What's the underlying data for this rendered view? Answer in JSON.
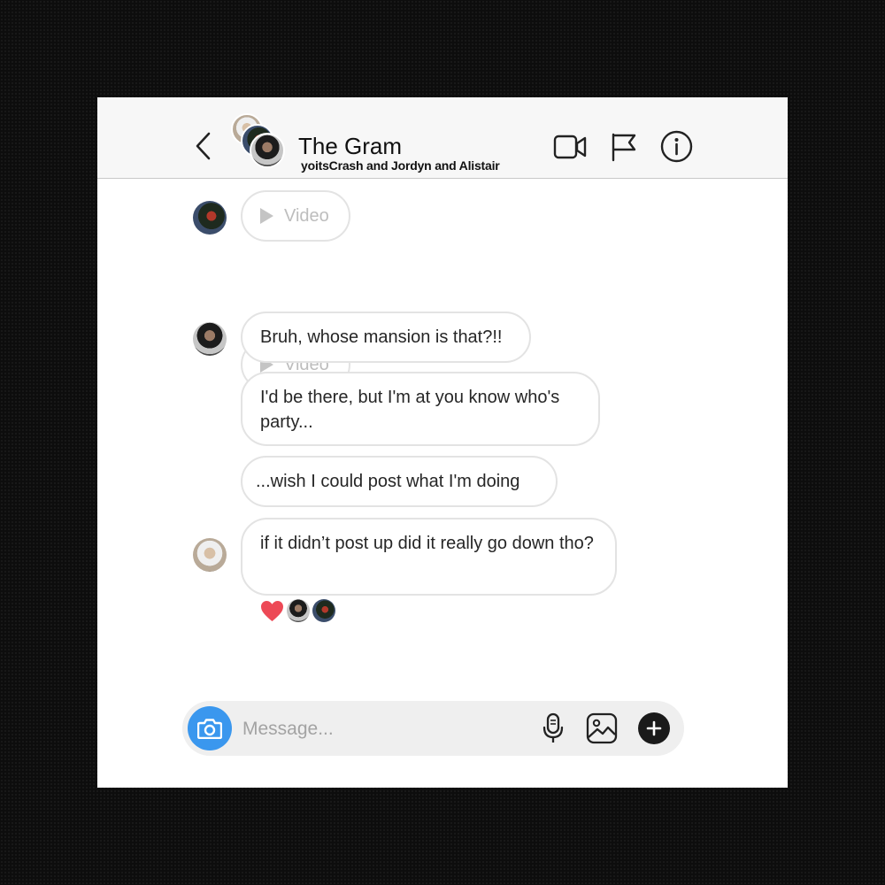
{
  "header": {
    "title": "The Gram",
    "participants": "yoitsCrash and Jordyn and Alistair",
    "icons": [
      "back-chevron-icon",
      "video-call-icon",
      "flag-icon",
      "info-icon"
    ]
  },
  "messages": [
    {
      "sender": "user-red",
      "type": "video",
      "label": "Video"
    },
    {
      "sender": "user-red",
      "type": "video",
      "label": "Video"
    },
    {
      "sender": "user-beard",
      "type": "text",
      "text": "Bruh, whose mansion is that?!!"
    },
    {
      "sender": "user-beard",
      "type": "text",
      "text": "I'd be there, but I'm at you know who's party..."
    },
    {
      "sender": "user-beard",
      "type": "text",
      "text": "...wish I could post what I'm doing"
    },
    {
      "sender": "user-smile",
      "type": "text",
      "text": "if it didn’t post up did it really go down tho?"
    }
  ],
  "reactions": [
    "heart",
    "user-beard",
    "user-red"
  ],
  "composer": {
    "placeholder": "Message...",
    "icons": [
      "camera-icon",
      "microphone-icon",
      "gallery-icon",
      "plus-icon"
    ]
  },
  "colors": {
    "background": "#0d0d0d",
    "camera_button": "#3a97ee",
    "heart": "#ed4956",
    "bubble_border": "#e3e3e3"
  }
}
